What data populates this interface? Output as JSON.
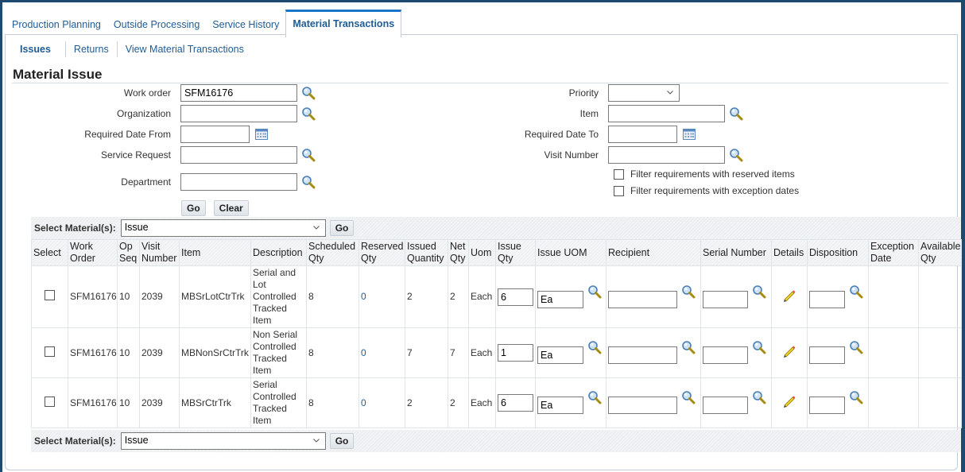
{
  "tabs": [
    {
      "label": "Production Planning",
      "active": false
    },
    {
      "label": "Outside Processing",
      "active": false
    },
    {
      "label": "Service History",
      "active": false
    },
    {
      "label": "Material Transactions",
      "active": true
    }
  ],
  "subtabs": [
    {
      "label": "Issues",
      "active": true
    },
    {
      "label": "Returns",
      "active": false
    },
    {
      "label": "View Material Transactions",
      "active": false
    }
  ],
  "page_title": "Material Issue",
  "search": {
    "work_order": {
      "label": "Work order",
      "value": "SFM16176"
    },
    "organization": {
      "label": "Organization",
      "value": ""
    },
    "required_date_from": {
      "label": "Required Date From",
      "value": ""
    },
    "service_request": {
      "label": "Service Request",
      "value": ""
    },
    "department": {
      "label": "Department",
      "value": ""
    },
    "priority": {
      "label": "Priority",
      "value": ""
    },
    "item": {
      "label": "Item",
      "value": ""
    },
    "required_date_to": {
      "label": "Required Date To",
      "value": ""
    },
    "visit_number": {
      "label": "Visit Number",
      "value": ""
    },
    "filter_reserved": {
      "label": "Filter requirements with reserved items",
      "checked": false
    },
    "filter_exception": {
      "label": "Filter requirements with exception dates",
      "checked": false
    },
    "go_label": "Go",
    "clear_label": "Clear"
  },
  "material_select": {
    "label": "Select Material(s):",
    "value": "Issue",
    "go_label": "Go"
  },
  "table": {
    "columns": [
      "Select",
      "Work Order",
      "Op Seq",
      "Visit Number",
      "Item",
      "Description",
      "Scheduled Qty",
      "Reserved Qty",
      "Issued Quantity",
      "Net Qty",
      "Uom",
      "Issue Qty",
      "Issue UOM",
      "Recipient",
      "Serial Number",
      "Details",
      "Disposition",
      "Exception Date",
      "Available Qty"
    ],
    "rows": [
      {
        "work_order": "SFM16176",
        "op_seq": "10",
        "visit_number": "2039",
        "item": "MBSrLotCtrTrk",
        "description": "Serial and Lot Controlled Tracked Item",
        "scheduled_qty": "8",
        "reserved_qty": "0",
        "issued_quantity": "2",
        "net_qty": "2",
        "uom": "Each",
        "issue_qty": "6",
        "issue_uom": "Ea",
        "recipient": "",
        "serial_number": "",
        "disposition": "",
        "exception_date": "",
        "available_qty": ""
      },
      {
        "work_order": "SFM16176",
        "op_seq": "10",
        "visit_number": "2039",
        "item": "MBNonSrCtrTrk",
        "description": "Non Serial Controlled Tracked Item",
        "scheduled_qty": "8",
        "reserved_qty": "0",
        "issued_quantity": "7",
        "net_qty": "7",
        "uom": "Each",
        "issue_qty": "1",
        "issue_uom": "Ea",
        "recipient": "",
        "serial_number": "",
        "disposition": "",
        "exception_date": "",
        "available_qty": ""
      },
      {
        "work_order": "SFM16176",
        "op_seq": "10",
        "visit_number": "2039",
        "item": "MBSrCtrTrk",
        "description": "Serial Controlled Tracked Item",
        "scheduled_qty": "8",
        "reserved_qty": "0",
        "issued_quantity": "2",
        "net_qty": "2",
        "uom": "Each",
        "issue_qty": "6",
        "issue_uom": "Ea",
        "recipient": "",
        "serial_number": "",
        "disposition": "",
        "exception_date": "",
        "available_qty": ""
      }
    ]
  },
  "colors": {
    "background": "#1d4a6e",
    "link": "#1f5c96",
    "active_tab_border": "#1b75c8"
  }
}
